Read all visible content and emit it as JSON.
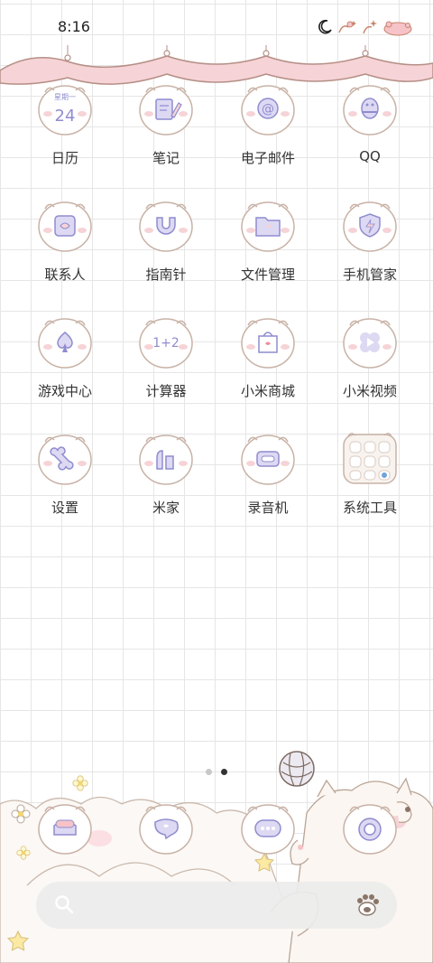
{
  "status_bar": {
    "time": "8:16",
    "icons": [
      "moon-icon",
      "sparkle-icon",
      "sparkle-icon",
      "battery-icon"
    ]
  },
  "apps": [
    {
      "label": "日历",
      "icon": "calendar-icon",
      "calendar_weekday": "星期一",
      "calendar_day": "24"
    },
    {
      "label": "笔记",
      "icon": "notes-icon"
    },
    {
      "label": "电子邮件",
      "icon": "email-icon"
    },
    {
      "label": "QQ",
      "icon": "qq-icon"
    },
    {
      "label": "联系人",
      "icon": "contacts-icon"
    },
    {
      "label": "指南针",
      "icon": "compass-icon"
    },
    {
      "label": "文件管理",
      "icon": "folder-icon"
    },
    {
      "label": "手机管家",
      "icon": "security-icon"
    },
    {
      "label": "游戏中心",
      "icon": "game-center-icon"
    },
    {
      "label": "计算器",
      "icon": "calculator-icon",
      "calc_text": "1+2"
    },
    {
      "label": "小米商城",
      "icon": "mi-store-icon"
    },
    {
      "label": "小米视频",
      "icon": "mi-video-icon"
    },
    {
      "label": "设置",
      "icon": "settings-icon"
    },
    {
      "label": "米家",
      "icon": "mijia-icon"
    },
    {
      "label": "录音机",
      "icon": "recorder-icon"
    },
    {
      "label": "系统工具",
      "icon": "system-tools-folder-icon"
    }
  ],
  "page_indicator": {
    "count": 2,
    "active": 2
  },
  "dock": [
    "phone-icon",
    "messages-icon",
    "chat-icon",
    "camera-icon"
  ],
  "search": {
    "placeholder": ""
  },
  "colors": {
    "accent_purple": "#8f8ccf",
    "pink": "#f3c9cf",
    "outline": "#8a7568",
    "grid": "#e6e6e6"
  }
}
